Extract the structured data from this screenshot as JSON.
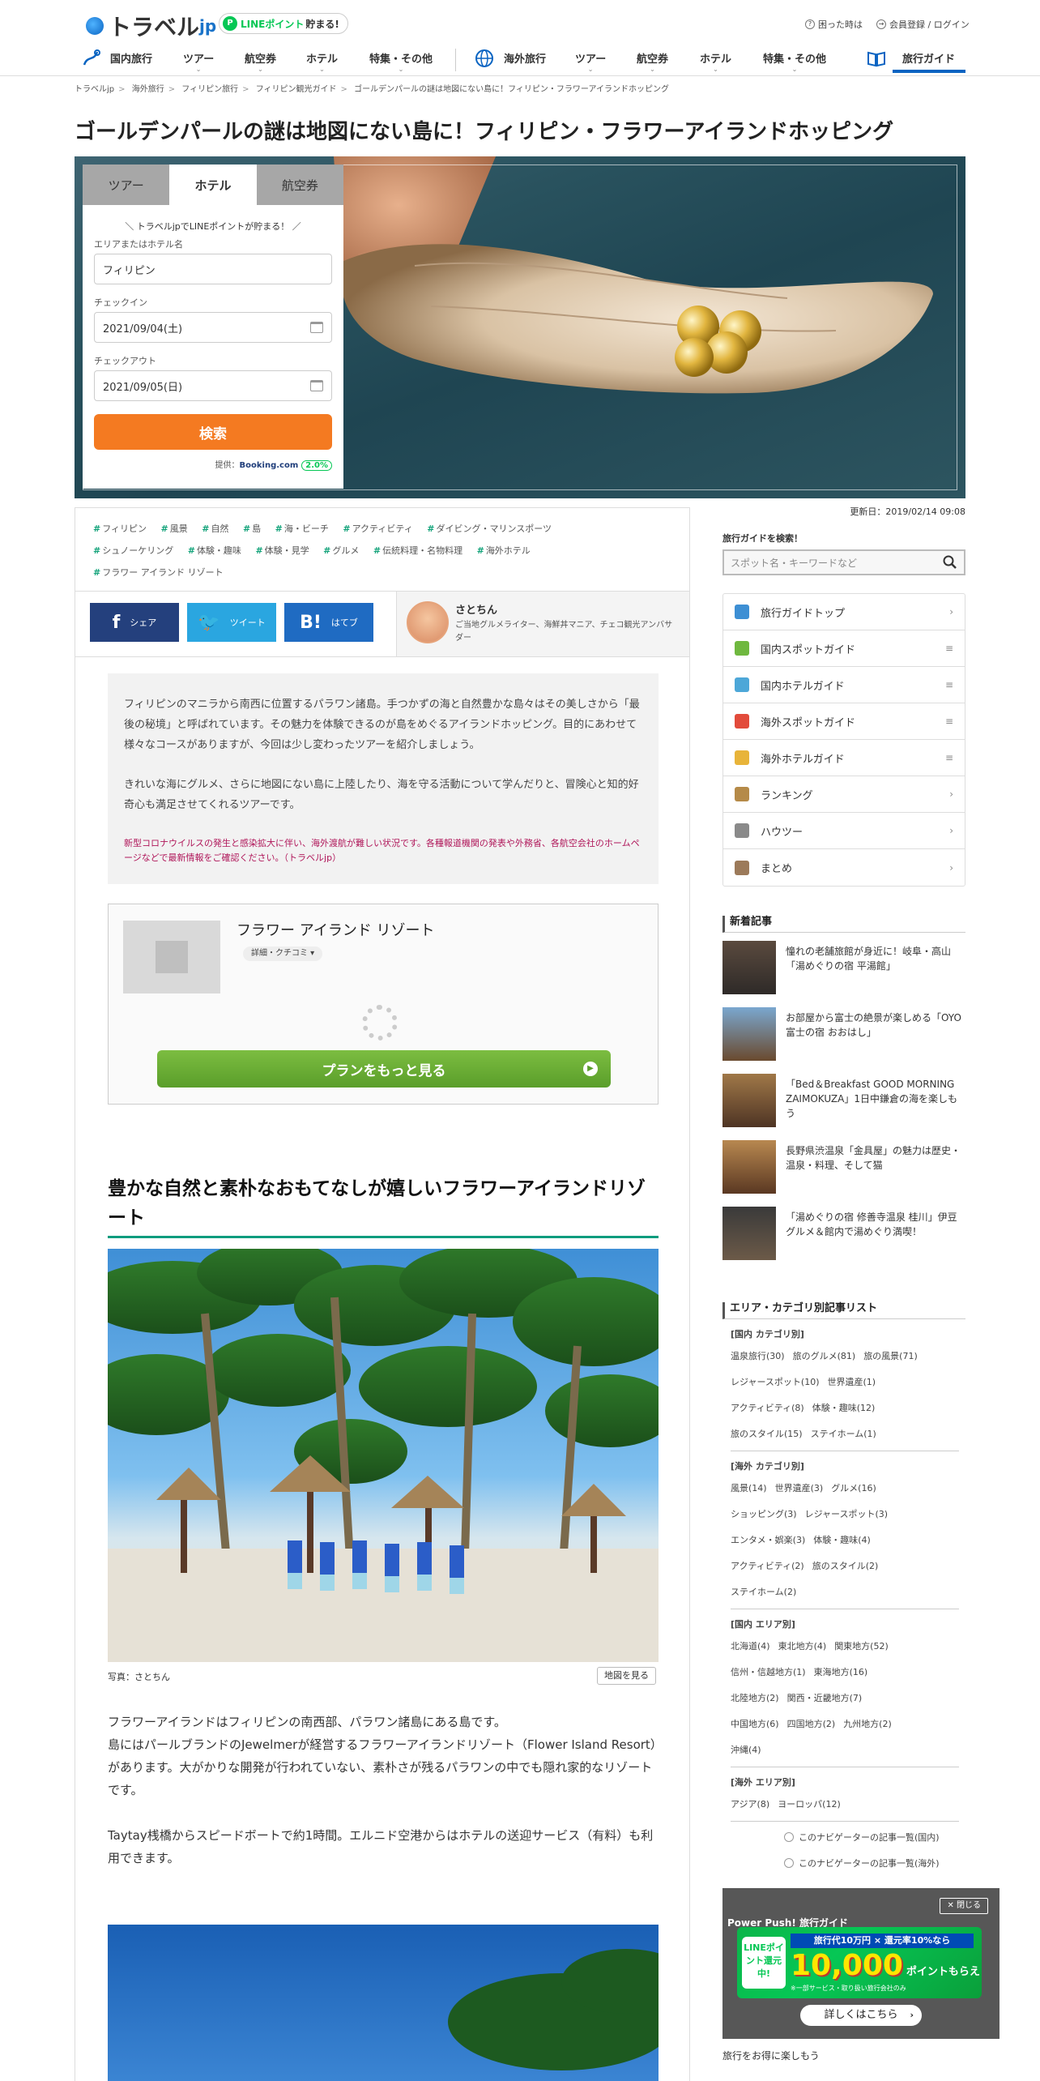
{
  "header": {
    "logo_text": "トラベル",
    "logo_suffix": "jp",
    "line_badge_logo": "P",
    "line_badge_line": "LINEポイント",
    "line_badge_text": "貯まる!",
    "help": "困った時は",
    "login": "会員登録 / ログイン"
  },
  "nav": {
    "domestic": "国内旅行",
    "domestic_tour": "ツアー",
    "domestic_air": "航空券",
    "domestic_hotel": "ホテル",
    "domestic_special": "特集・その他",
    "overseas": "海外旅行",
    "overseas_tour": "ツアー",
    "overseas_air": "航空券",
    "overseas_hotel": "ホテル",
    "overseas_special": "特集・その他",
    "guide": "旅行ガイド"
  },
  "breadcrumb": [
    "トラベルjp",
    "海外旅行",
    "フィリピン旅行",
    "フィリピン観光ガイド",
    "ゴールデンパールの謎は地図にない島に！フィリピン・フラワーアイランドホッピング"
  ],
  "article": {
    "title": "ゴールデンパールの謎は地図にない島に！フィリピン・フラワーアイランドホッピング",
    "updated": "更新日：2019/02/14 09:08",
    "tags": [
      "フィリピン",
      "風景",
      "自然",
      "島",
      "海・ビーチ",
      "アクティビティ",
      "ダイビング・マリンスポーツ",
      "シュノーケリング",
      "体験・趣味",
      "体験・見学",
      "グルメ",
      "伝統料理・名物料理",
      "海外ホテル",
      "フラワー アイランド リゾート"
    ],
    "intro_p1": "フィリピンのマニラから南西に位置するパラワン諸島。手つかずの海と自然豊かな島々はその美しさから「最後の秘境」と呼ばれています。その魅力を体験できるのが島をめぐるアイランドホッピング。目的にあわせて様々なコースがありますが、今回は少し変わったツアーを紹介しましょう。",
    "intro_p2": "きれいな海にグルメ、さらに地図にない島に上陸したり、海を守る活動について学んだりと、冒険心と知的好奇心も満足させてくれるツアーです。",
    "intro_warn": "新型コロナウイルスの発生と感染拡大に伴い、海外渡航が難しい状況です。各種報道機関の発表や外務省、各航空会社のホームページなどで最新情報をご確認ください。（トラベルjp）",
    "section1_title": "豊かな自然と素朴なおもてなしが嬉しいフラワーアイランドリゾート",
    "photo_caption": "写真：さとちん",
    "map_button": "地図を見る",
    "body_p1": "フラワーアイランドはフィリピンの南西部、パラワン諸島にある島です。\n島にはパールブランドのJewelmerが経営するフラワーアイランドリゾート（Flower Island Resort）があります。大がかりな開発が行われていない、素朴さが残るパラワンの中でも隠れ家的なリゾートです。",
    "body_p2": "Taytay桟橋からスピードボートで約1時間。エルニド空港からはホテルの送迎サービス（有料）も利用できます。"
  },
  "share": {
    "facebook_glyph": "f",
    "facebook": "シェア",
    "twitter_glyph": "🐦",
    "twitter": "ツイート",
    "hatena_glyph": "B!",
    "hatena": "はてブ"
  },
  "author": {
    "name": "さとちん",
    "desc": "ご当地グルメライター、海鮮丼マニア、チェコ観光アンバサダー"
  },
  "search": {
    "tabs": [
      "ツアー",
      "ホテル",
      "航空券"
    ],
    "active_tab": "ホテル",
    "promo": "＼ トラベルjpでLINEポイントが貯まる！ ／",
    "area_label": "エリアまたはホテル名",
    "area_value": "フィリピン",
    "checkin_label": "チェックイン",
    "checkin_value": "2021/09/04(土)",
    "checkout_label": "チェックアウト",
    "checkout_value": "2021/09/05(日)",
    "button": "検索",
    "provider_prefix": "提供：",
    "provider": "Booking.com",
    "point_rate": "2.0%"
  },
  "hotel_card": {
    "name": "フラワー アイランド リゾート",
    "detail": "詳細・クチコミ ▾",
    "plan_button": "プランをもっと見る"
  },
  "sidebar": {
    "search_label": "旅行ガイドを検索！",
    "search_placeholder": "スポット名・キーワードなど",
    "menu": [
      {
        "label": "旅行ガイドトップ",
        "arrow": "›"
      },
      {
        "label": "国内スポットガイド",
        "arrow": "≡"
      },
      {
        "label": "国内ホテルガイド",
        "arrow": "≡"
      },
      {
        "label": "海外スポットガイド",
        "arrow": "≡"
      },
      {
        "label": "海外ホテルガイド",
        "arrow": "≡"
      },
      {
        "label": "ランキング",
        "arrow": "›"
      },
      {
        "label": "ハウツー",
        "arrow": "›"
      },
      {
        "label": "まとめ",
        "arrow": "›"
      }
    ],
    "news_title": "新着記事",
    "news": [
      "憧れの老舗旅館が身近に！岐阜・高山「湯めぐりの宿 平湯館」",
      "お部屋から富士の絶景が楽しめる「OYO 富士の宿 おおはし」",
      "「Bed＆Breakfast GOOD MORNING ZAIMOKUZA」1日中鎌倉の海を楽しもう",
      "長野県渋温泉「金具屋」の魅力は歴史・温泉・料理、そして猫",
      "「湯めぐりの宿 修善寺温泉 桂川」伊豆グルメ＆館内で湯めぐり満喫！"
    ],
    "cats_title": "エリア・カテゴリ別記事リスト",
    "dom_cat_label": "[国内 カテゴリ別]",
    "dom_cat": [
      "温泉旅行(30)",
      "旅のグルメ(81)",
      "旅の風景(71)",
      "レジャースポット(10)",
      "世界遺産(1)",
      "アクティビティ(8)",
      "体験・趣味(12)",
      "旅のスタイル(15)",
      "ステイホーム(1)"
    ],
    "ovs_cat_label": "[海外 カテゴリ別]",
    "ovs_cat": [
      "風景(14)",
      "世界遺産(3)",
      "グルメ(16)",
      "ショッピング(3)",
      "レジャースポット(3)",
      "エンタメ・娯楽(3)",
      "体験・趣味(4)",
      "アクティビティ(2)",
      "旅のスタイル(2)",
      "ステイホーム(2)"
    ],
    "dom_area_label": "[国内 エリア別]",
    "dom_area": [
      "北海道(4)",
      "東北地方(4)",
      "関東地方(52)",
      "信州・信越地方(1)",
      "東海地方(16)",
      "北陸地方(2)",
      "関西・近畿地方(7)",
      "中国地方(6)",
      "四国地方(2)",
      "九州地方(2)",
      "沖縄(4)"
    ],
    "ovs_area_label": "[海外 エリア別]",
    "ovs_area": [
      "アジア(8)",
      "ヨーロッパ(12)"
    ],
    "nav_dom": "このナビゲーターの記事一覧(国内)",
    "nav_ovs": "このナビゲーターの記事一覧(海外)",
    "peek_text": "旅行をお得に楽しもう"
  },
  "popup": {
    "close": "閉じる",
    "heading": "Power Push! 旅行ガイド",
    "banner_line": "LINEポイント還元中!",
    "banner_top": "旅行代10万円 × 還元率10%なら",
    "banner_big": "10,000",
    "banner_unit": "ポイントもらえる!",
    "banner_note": "※一部サービス・取り扱い旅行会社のみ",
    "more": "詳しくはこちら"
  },
  "colors": {
    "brand_blue": "#0a64c2",
    "search_orange": "#f47a21",
    "plan_green": "#5a9e2a",
    "tag_green": "#13a37a",
    "warn_red": "#b0175a"
  }
}
